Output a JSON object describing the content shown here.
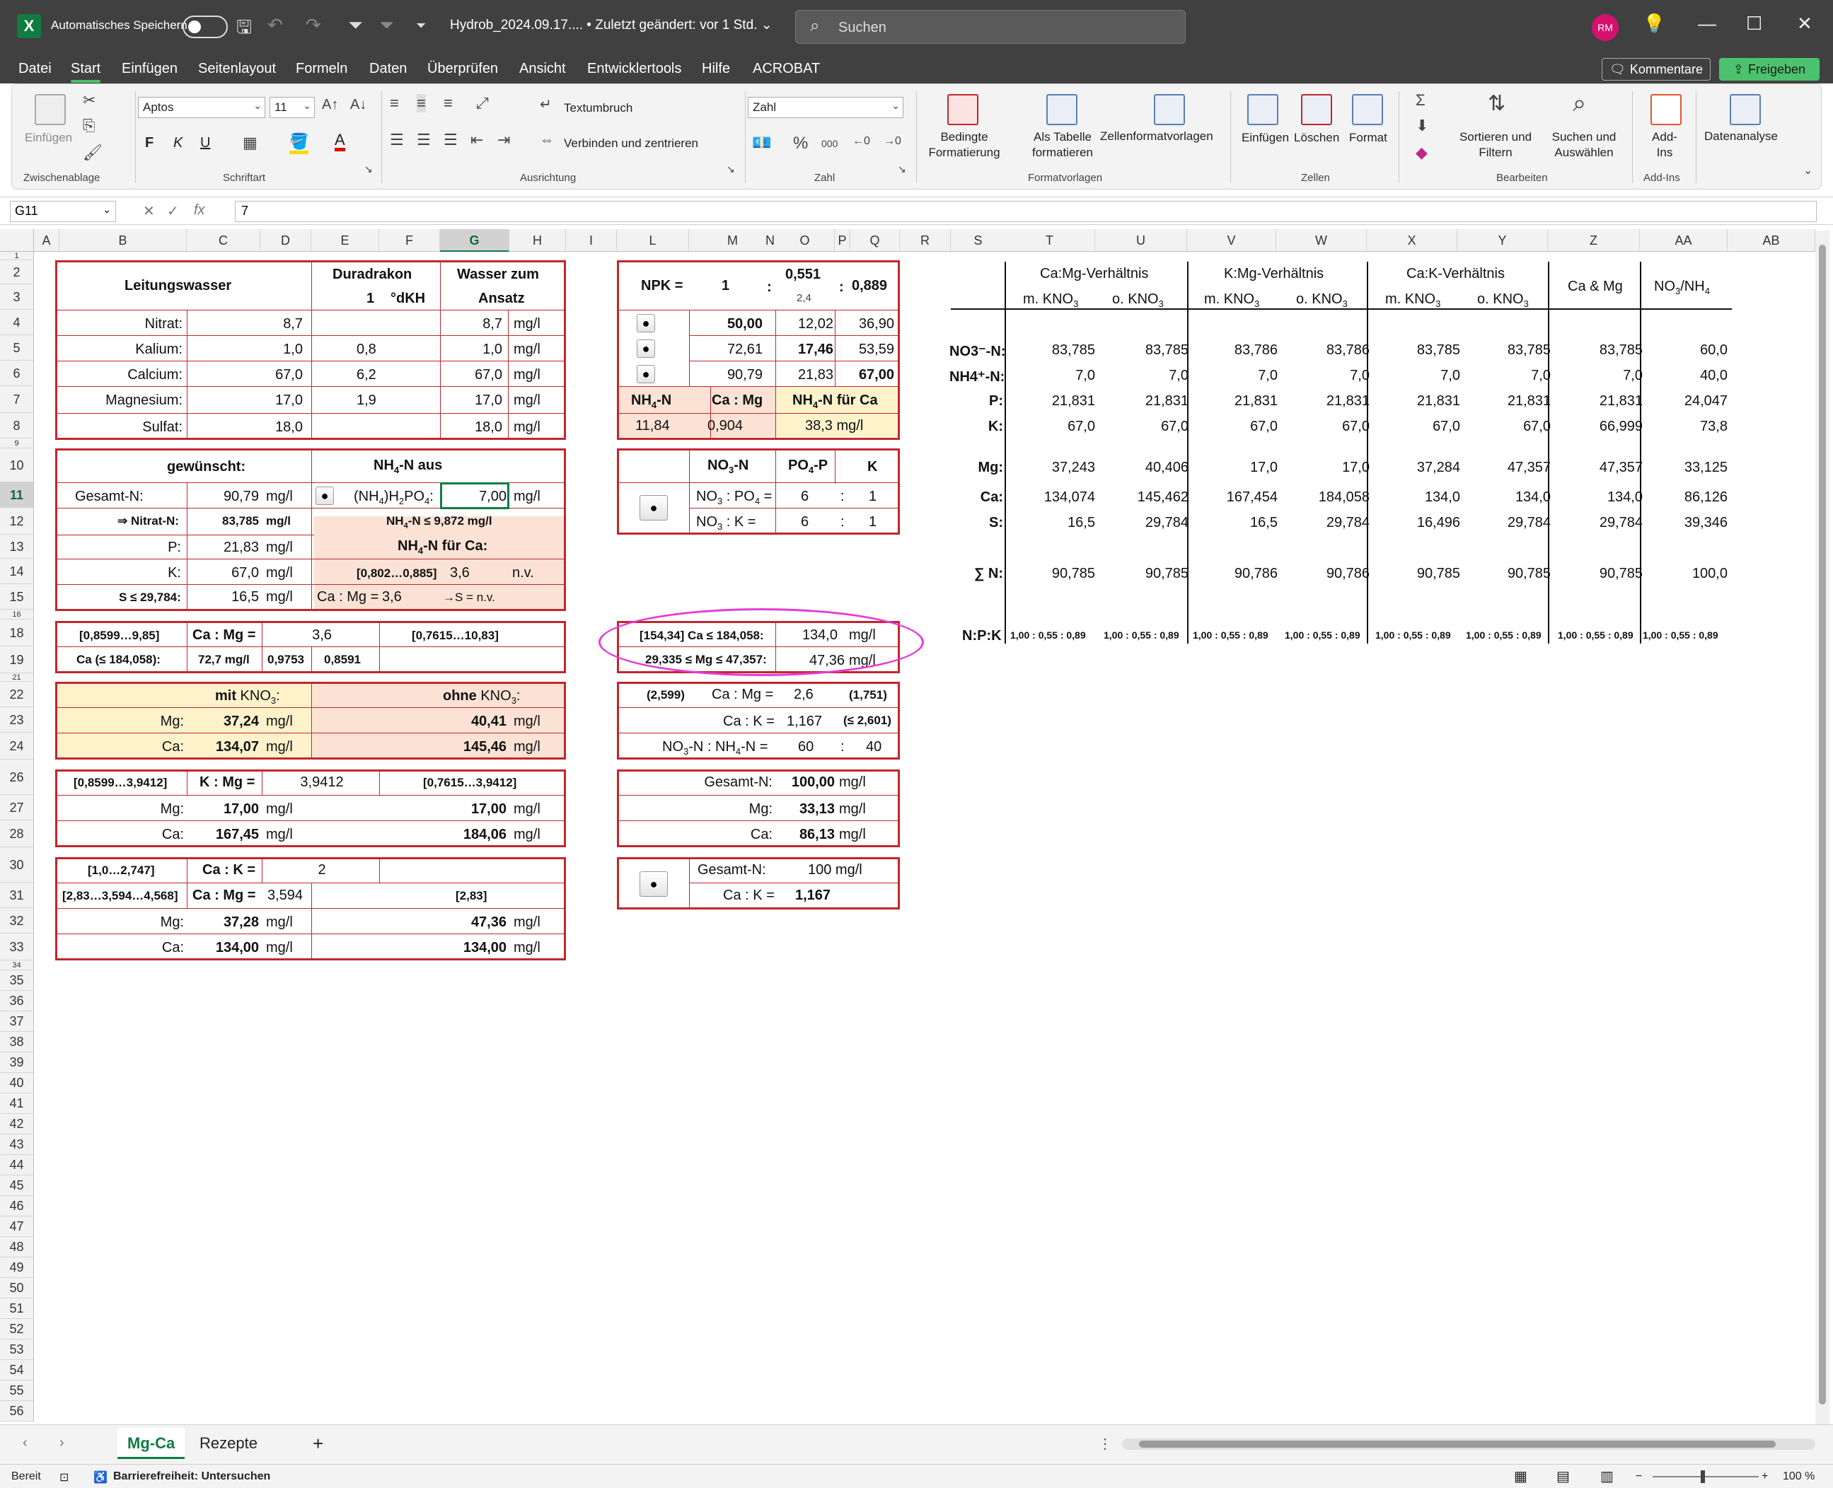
{
  "titlebar": {
    "app_letter": "X",
    "autosave_label": "Automatisches Speichern",
    "filename": "Hydrob_2024.09.17.... • Zuletzt geändert: vor 1 Std. ⌄",
    "search_placeholder": "Suchen",
    "avatar": "RM"
  },
  "menu": [
    "Datei",
    "Start",
    "Einfügen",
    "Seitenlayout",
    "Formeln",
    "Daten",
    "Überprüfen",
    "Ansicht",
    "Entwicklertools",
    "Hilfe",
    "ACROBAT"
  ],
  "menu_active": "Start",
  "buttons": {
    "comments": "Kommentare",
    "share": "Freigeben"
  },
  "ribbon": {
    "paste": "Einfügen",
    "font_name": "Aptos",
    "font_size": "11",
    "bold": "F",
    "italic": "K",
    "underline": "U",
    "wrap": "Textumbruch",
    "merge": "Verbinden und zentrieren",
    "number_format": "Zahl",
    "cond_format": "Bedingte\nFormatierung",
    "as_table": "Als Tabelle\nformatieren",
    "cell_styles": "Zellenformatvorlagen",
    "insert": "Einfügen",
    "delete": "Löschen",
    "format": "Format",
    "sort_filter": "Sortieren und\nFiltern",
    "find_select": "Suchen und\nAuswählen",
    "addins": "Add-\nIns",
    "data_analysis": "Datenanalyse",
    "groups": [
      "Zwischenablage",
      "Schriftart",
      "Ausrichtung",
      "Zahl",
      "Formatvorlagen",
      "Zellen",
      "Bearbeiten",
      "Add-Ins"
    ]
  },
  "formula_bar": {
    "name_box": "G11",
    "fx": "fx",
    "value": "7"
  },
  "columns": [
    "A",
    "B",
    "C",
    "D",
    "E",
    "F",
    "G",
    "H",
    "I",
    "L",
    "M",
    "N",
    "O",
    "P",
    "Q",
    "R",
    "S",
    "T",
    "U",
    "V",
    "W",
    "X",
    "Y",
    "Z",
    "AA",
    "AB"
  ],
  "rows": [
    "1",
    "2",
    "3",
    "4",
    "5",
    "6",
    "7",
    "8",
    "9",
    "10",
    "11",
    "12",
    "13",
    "14",
    "15",
    "16",
    "18",
    "19",
    "21",
    "22",
    "23",
    "24",
    "26",
    "27",
    "28",
    "30",
    "31",
    "32",
    "33",
    "34",
    "35",
    "36",
    "37",
    "38",
    "39",
    "40",
    "41",
    "42",
    "43",
    "44",
    "45",
    "46",
    "47",
    "48",
    "49",
    "50",
    "51",
    "52",
    "53",
    "54",
    "55",
    "56"
  ],
  "blk1": {
    "leitungswasser": "Leitungswasser",
    "duradrakon": "Duradrakon",
    "one": "1",
    "dkh": "°dKH",
    "wasser": "Wasser zum",
    "ansatz": "Ansatz",
    "rows": [
      {
        "label": "Nitrat:",
        "c": "8,7",
        "e": "",
        "g": "8,7",
        "h": "mg/l"
      },
      {
        "label": "Kalium:",
        "c": "1,0",
        "e": "0,8",
        "g": "1,0",
        "h": "mg/l"
      },
      {
        "label": "Calcium:",
        "c": "67,0",
        "e": "6,2",
        "g": "67,0",
        "h": "mg/l"
      },
      {
        "label": "Magnesium:",
        "c": "17,0",
        "e": "1,9",
        "g": "17,0",
        "h": "mg/l"
      },
      {
        "label": "Sulfat:",
        "c": "18,0",
        "e": "",
        "g": "18,0",
        "h": "mg/l"
      }
    ]
  },
  "blk2": {
    "gewuenscht": "gewünscht:",
    "nh4_aus": "NH4-N aus",
    "gesamt_n_label": "Gesamt-N:",
    "gesamt_n": "90,79",
    "unit": "mg/l",
    "radio": "●",
    "nh4h2po4": "(NH4)H2PO4:",
    "nh4h2po4_val": "7,00",
    "nitrat_label": "⇒ Nitrat-N:",
    "nitrat_val": "83,785",
    "nh4_limit": "NH4-N ≤ 9,872 mg/l",
    "p_label": "P:",
    "p_val": "21,83",
    "nh4_ca": "NH4-N für Ca:",
    "k_label": "K:",
    "k_val": "67,0",
    "range": "[0,802…0,885]",
    "range_val": "3,6",
    "nv": "n.v.",
    "s_label": "S ≤ 29,784:",
    "s_val": "16,5",
    "camg": "Ca : Mg =",
    "camg_val": "3,6",
    "s_arrow": "→S = n.v."
  },
  "blk3": {
    "range": "[0,8599…9,85]",
    "camg": "Ca : Mg =",
    "camg_val": "3,6",
    "range2": "[0,7615…10,83]",
    "ca_label": "Ca (≤ 184,058):",
    "ca_val": "72,7 mg/l",
    "f1": "0,9753",
    "f2": "0,8591"
  },
  "blk4": {
    "mit": "mit KNO3:",
    "ohne": "ohne KNO3:",
    "mg_label": "Mg:",
    "mg_mit": "37,24",
    "mg_ohne": "40,41",
    "ca_label": "Ca:",
    "ca_mit": "134,07",
    "ca_ohne": "145,46",
    "unit": "mg/l"
  },
  "blk5": {
    "range": "[0,8599…3,9412]",
    "kmg": "K : Mg =",
    "kmg_val": "3,9412",
    "range2": "[0,7615…3,9412]",
    "mg_label": "Mg:",
    "mg1": "17,00",
    "mg2": "17,00",
    "ca_label": "Ca:",
    "ca1": "167,45",
    "ca2": "184,06",
    "unit": "mg/l"
  },
  "blk6": {
    "range": "[1,0…2,747]",
    "cak": "Ca : K =",
    "cak_val": "2",
    "range_b": "[2,83…3,594…4,568]",
    "camg": "Ca : Mg =",
    "camg_val": "3,594",
    "range2": "[2,83]",
    "mg_label": "Mg:",
    "mg1": "37,28",
    "mg2": "47,36",
    "ca_label": "Ca:",
    "ca1": "134,00",
    "ca2": "134,00",
    "unit": "mg/l"
  },
  "npk": {
    "label": "NPK =",
    "n": "1",
    "colon": ":",
    "p": "0,551",
    "p_sub": "2,4",
    "k": "0,889",
    "radio": "●",
    "rows": [
      {
        "m": "50,00",
        "o": "12,02",
        "q": "36,90",
        "bold": "m"
      },
      {
        "m": "72,61",
        "o": "17,46",
        "q": "53,59",
        "bold": "o"
      },
      {
        "m": "90,79",
        "o": "21,83",
        "q": "67,00",
        "bold": "q"
      }
    ],
    "nh4n": "NH4-N",
    "camg": "Ca : Mg",
    "nh4ca": "NH4-N für Ca",
    "nh4n_val": "11,84",
    "camg_val": "0,904",
    "nh4ca_val": "38,3 mg/l"
  },
  "ratio": {
    "no3n": "NO3-N",
    "po4p": "PO4-P",
    "k": "K",
    "no3po4": "NO3 : PO4 =",
    "no3po4_a": "6",
    "no3po4_b": "1",
    "no3k": "NO3 : K =",
    "no3k_a": "6",
    "no3k_b": "1",
    "colon": ":",
    "radio": "●"
  },
  "ellipse_blk": {
    "ca_range": "[154,34] Ca ≤ 184,058:",
    "ca_val": "134,0",
    "mg_range": "29,335 ≤ Mg ≤ 47,357:",
    "mg_val": "47,36",
    "unit": "mg/l"
  },
  "blk_r2": {
    "lo": "(2,599)",
    "camg": "Ca : Mg =",
    "camg_val": "2,6",
    "hi": "(1,751)",
    "cak": "Ca : K =",
    "cak_val": "1,167",
    "cak_hi": "(≤ 2,601)",
    "no3nh4": "NO3-N : NH4-N =",
    "a": "60",
    "colon": ":",
    "b": "40"
  },
  "blk_r3": {
    "gesamt_label": "Gesamt-N:",
    "gesamt": "100,00",
    "mg_label": "Mg:",
    "mg": "33,13",
    "ca_label": "Ca:",
    "ca": "86,13",
    "unit": "mg/l"
  },
  "blk_r4": {
    "radio": "●",
    "gesamt_label": "Gesamt-N:",
    "gesamt": "100 mg/l",
    "cak": "Ca : K =",
    "cak_val": "1,167"
  },
  "right_table": {
    "groups": [
      "Ca:Mg-Verhältnis",
      "K:Mg-Verhältnis",
      "Ca:K-Verhältnis",
      "Ca & Mg",
      "NO3/NH4"
    ],
    "subheads": [
      "m. KNO3",
      "o. KNO3",
      "m. KNO3",
      "o. KNO3",
      "m. KNO3",
      "o. KNO3"
    ],
    "rows": [
      {
        "label": "NO3⁻-N:",
        "vals": [
          "83,785",
          "83,785",
          "83,786",
          "83,786",
          "83,785",
          "83,785",
          "83,785",
          "60,0"
        ]
      },
      {
        "label": "NH4⁺-N:",
        "vals": [
          "7,0",
          "7,0",
          "7,0",
          "7,0",
          "7,0",
          "7,0",
          "7,0",
          "40,0"
        ]
      },
      {
        "label": "P:",
        "vals": [
          "21,831",
          "21,831",
          "21,831",
          "21,831",
          "21,831",
          "21,831",
          "21,831",
          "24,047"
        ]
      },
      {
        "label": "K:",
        "vals": [
          "67,0",
          "67,0",
          "67,0",
          "67,0",
          "67,0",
          "67,0",
          "66,999",
          "73,8"
        ]
      },
      {
        "label": "Mg:",
        "vals": [
          "37,243",
          "40,406",
          "17,0",
          "17,0",
          "37,284",
          "47,357",
          "47,357",
          "33,125"
        ]
      },
      {
        "label": "Ca:",
        "vals": [
          "134,074",
          "145,462",
          "167,454",
          "184,058",
          "134,0",
          "134,0",
          "134,0",
          "86,126"
        ]
      },
      {
        "label": "S:",
        "vals": [
          "16,5",
          "29,784",
          "16,5",
          "29,784",
          "16,496",
          "29,784",
          "29,784",
          "39,346"
        ]
      },
      {
        "label": "∑ N:",
        "vals": [
          "90,785",
          "90,785",
          "90,786",
          "90,786",
          "90,785",
          "90,785",
          "90,785",
          "100,0"
        ]
      }
    ],
    "npk_label": "N:P:K",
    "npk_val": "1,00 : 0,55 : 0,89"
  },
  "sheets": {
    "active": "Mg-Ca",
    "other": "Rezepte",
    "add": "+"
  },
  "status": {
    "ready": "Bereit",
    "accessibility": "Barrierefreiheit: Untersuchen",
    "zoom": "100 %"
  }
}
